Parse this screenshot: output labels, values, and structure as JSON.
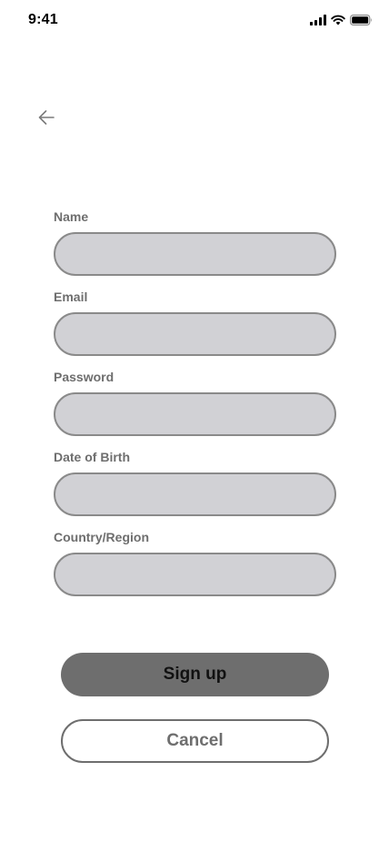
{
  "status_bar": {
    "time": "9:41",
    "icons": [
      "cellular-signal-icon",
      "wifi-icon",
      "battery-icon"
    ]
  },
  "nav": {
    "back_icon": "arrow-left-icon"
  },
  "form": {
    "fields": [
      {
        "label": "Name",
        "value": ""
      },
      {
        "label": "Email",
        "value": ""
      },
      {
        "label": "Password",
        "value": ""
      },
      {
        "label": "Date of Birth",
        "value": ""
      },
      {
        "label": "Country/Region",
        "value": ""
      }
    ]
  },
  "actions": {
    "signup_label": "Sign up",
    "cancel_label": "Cancel"
  },
  "colors": {
    "input_fill": "#d1d1d5",
    "input_border": "#8a8a8a",
    "label_text": "#6e6e6e",
    "primary_button": "#6e6e6e",
    "background": "#ffffff"
  }
}
